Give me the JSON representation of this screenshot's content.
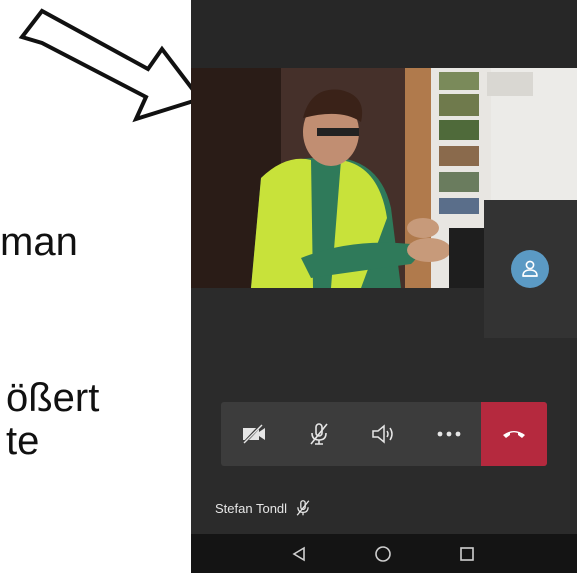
{
  "slide": {
    "fragment_1": "man",
    "fragment_2": "ößert",
    "fragment_3": "te"
  },
  "call": {
    "participant_name": "Stefan Tondl"
  },
  "controls": [
    {
      "name": "camera-off",
      "icon": "video-off-icon"
    },
    {
      "name": "mic-off",
      "icon": "mic-off-icon"
    },
    {
      "name": "speaker",
      "icon": "speaker-icon"
    },
    {
      "name": "more-options",
      "icon": "more-icon"
    },
    {
      "name": "hang-up",
      "icon": "hangup-icon"
    }
  ],
  "colors": {
    "hangup": "#b5293e",
    "avatar": "#5b9ac4",
    "controls_bg": "#3c3c3c",
    "screen_bg": "#2b2b2b"
  }
}
